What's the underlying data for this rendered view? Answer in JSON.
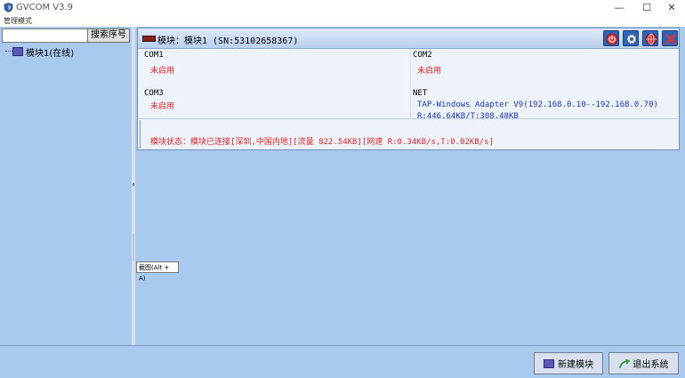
{
  "window": {
    "title": "GVCOM  V3.9"
  },
  "menu": {
    "item": "管理模式"
  },
  "window_controls": {
    "minimize": "—",
    "maximize": "☐",
    "close": "✕"
  },
  "search": {
    "value": "",
    "button": "搜索序号"
  },
  "tree": {
    "node": "模块1(在线)"
  },
  "splitter": {
    "arrow": "‹"
  },
  "module": {
    "title": "模块：模块1 (SN:53102658367)",
    "com1": {
      "label": "COM1",
      "value": "未启用"
    },
    "com2": {
      "label": "COM2",
      "value": "未启用"
    },
    "com3": {
      "label": "COM3",
      "value": "未启用"
    },
    "net": {
      "label": "NET",
      "adapter": "TAP-Windows Adapter V9(192.168.0.10--192.168.0.70)",
      "traffic": "R:446.64KB/T:308.48KB"
    },
    "status": "模块状态：模块已连接[深圳,中国内地][流量 822.54KB][网速 R:0.34KB/s,T:0.02KB/s]"
  },
  "tooltip": "截图(Alt + A)",
  "bottom": {
    "new_module": "新建模块",
    "exit": "退出系统"
  },
  "colors": {
    "pane_bg": "#a9c9ee",
    "status_red": "#e02424",
    "net_blue": "#1a33c8"
  }
}
